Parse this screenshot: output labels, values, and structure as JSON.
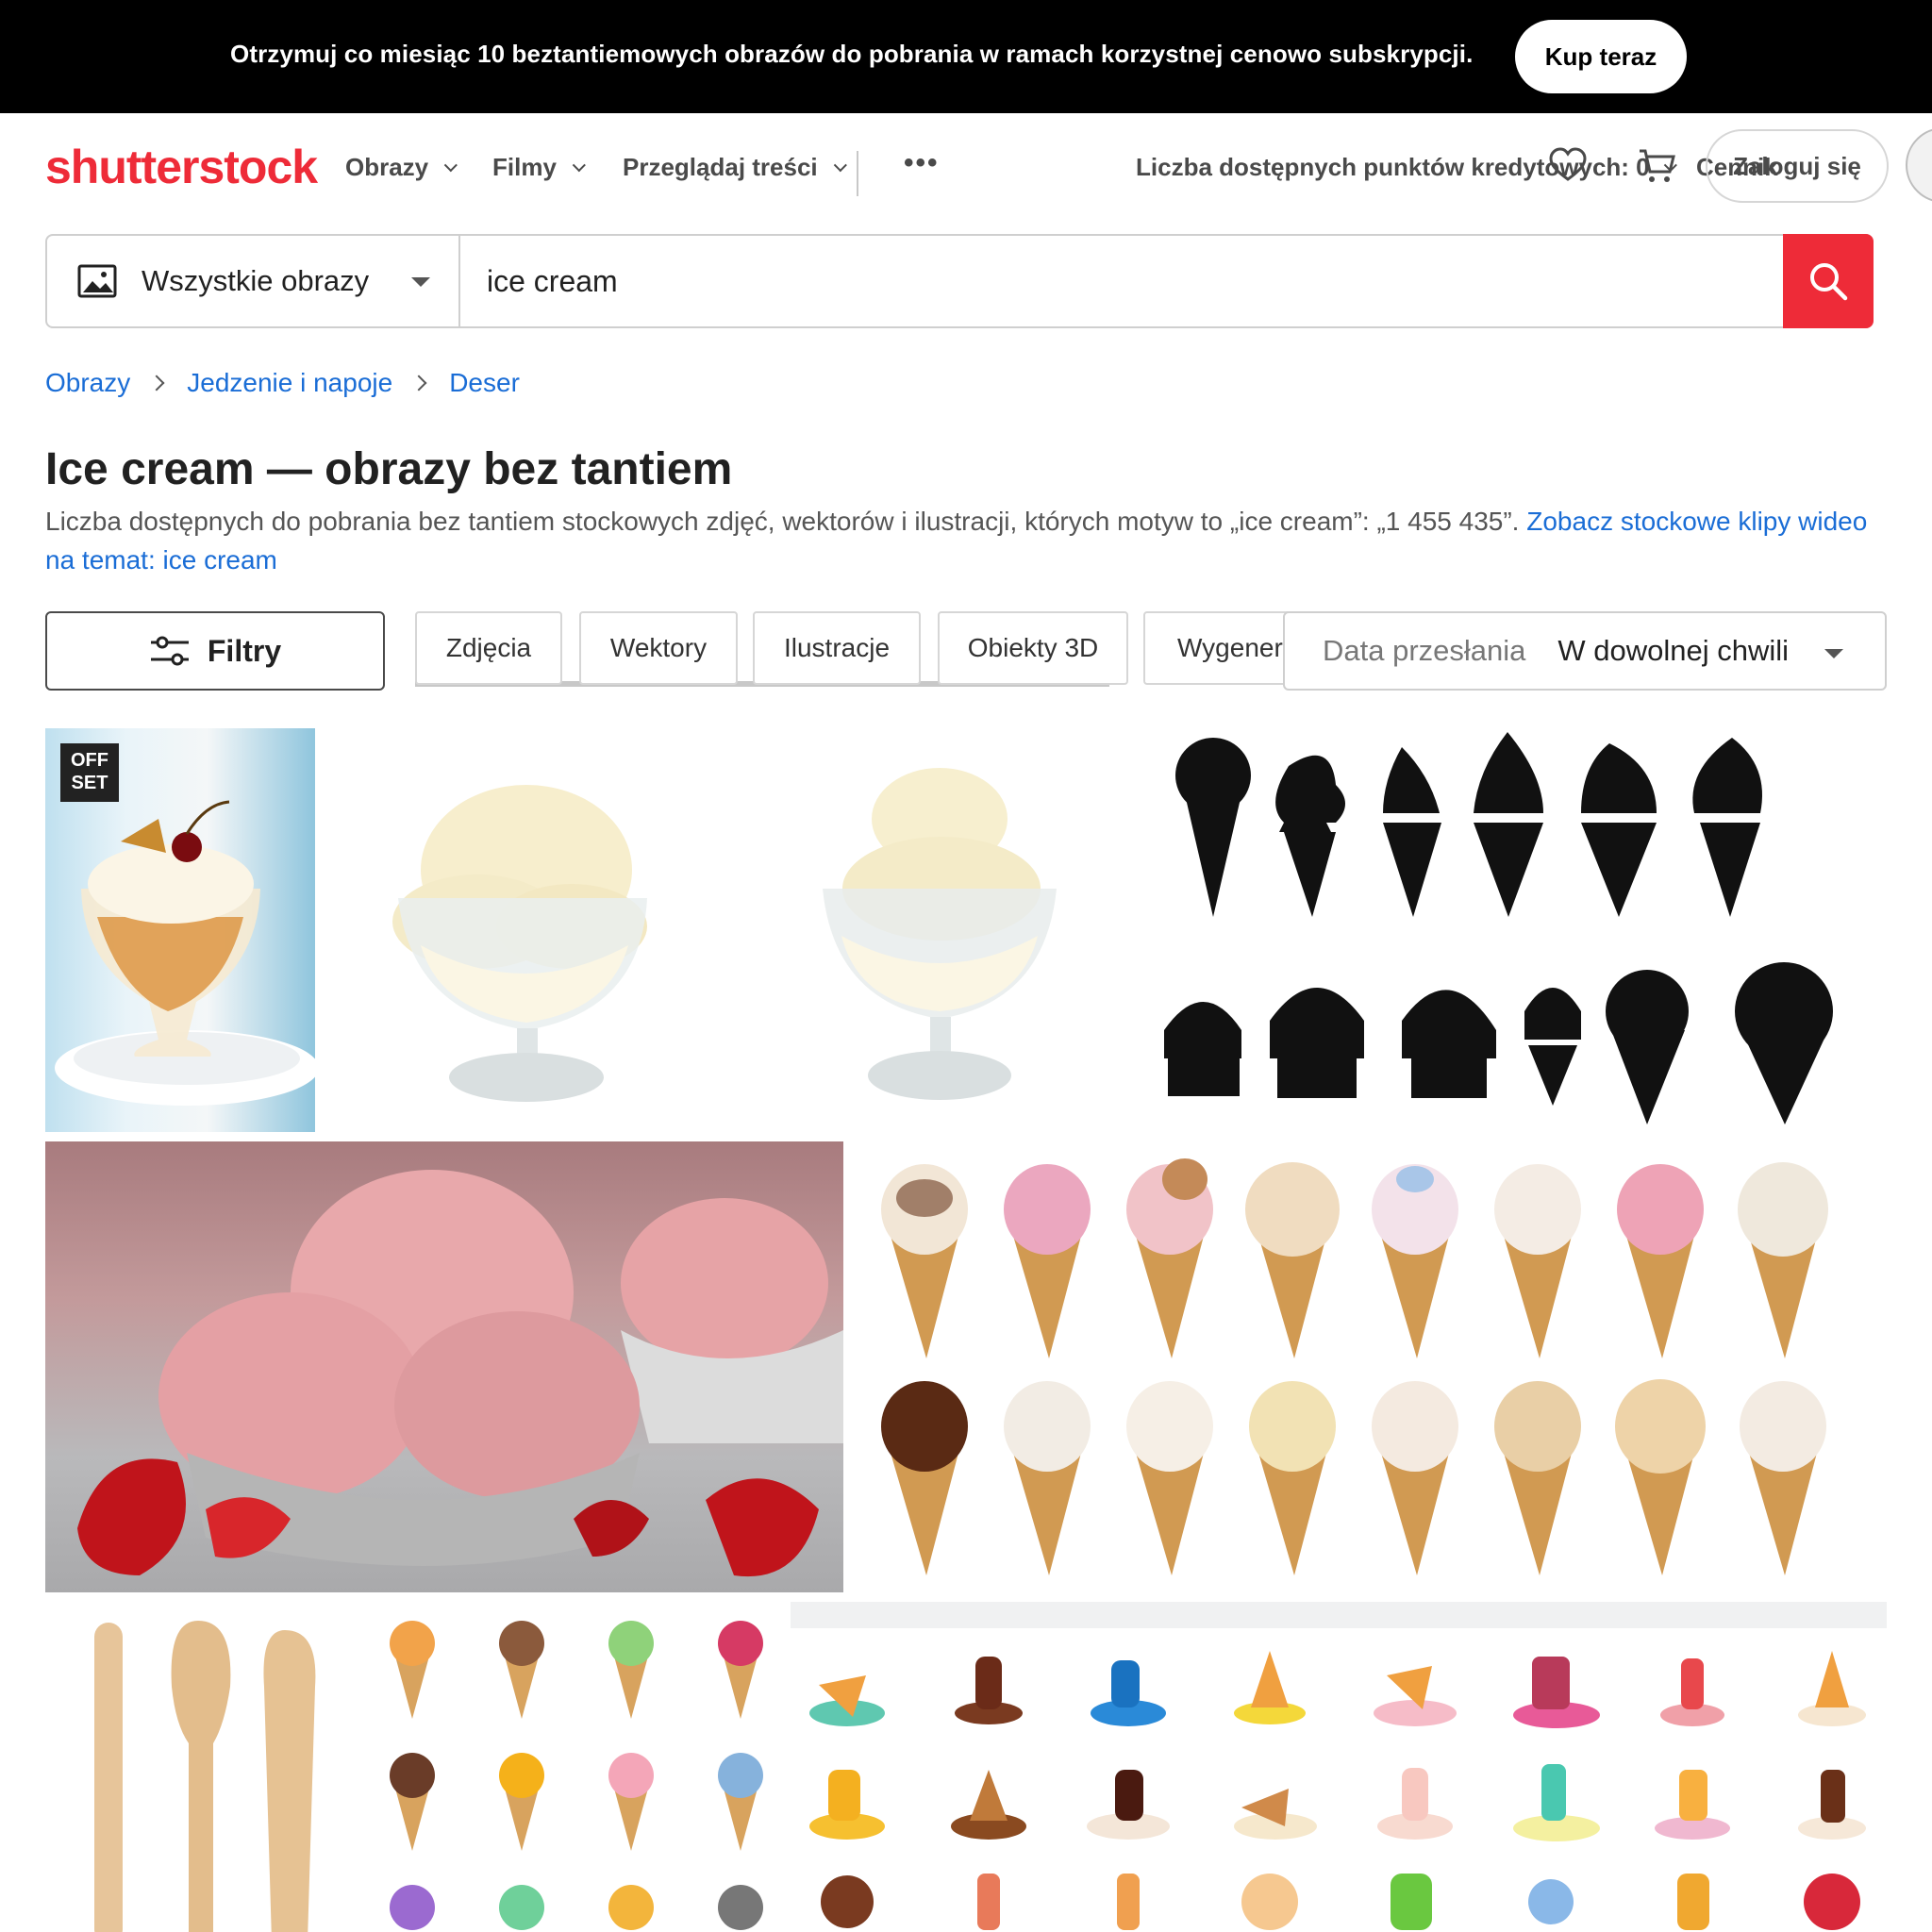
{
  "promo": {
    "text": "Otrzymuj co miesiąc 10 beztantiemowych obrazów do pobrania w ramach korzystnej cenowo subskrypcji.",
    "cta": "Kup teraz"
  },
  "header": {
    "logo": "shutterstock",
    "nav": [
      "Obrazy",
      "Filmy",
      "Przeglądaj treści"
    ],
    "more": "•••",
    "credits": "Liczba dostępnych punktów kredytowych: 0",
    "pricing": "Cennik",
    "login": "Zaloguj się"
  },
  "search": {
    "type": "Wszystkie obrazy",
    "query": "ice cream"
  },
  "breadcrumb": [
    "Obrazy",
    "Jedzenie i napoje",
    "Deser"
  ],
  "page": {
    "title": "Ice cream — obrazy bez tantiem",
    "subtitle": "Liczba dostępnych do pobrania bez tantiem stockowych zdjęć, wektorów i ilustracji, których motyw to „ice cream”: „1 455 435”.",
    "video_link": "Zobacz stockowe klipy wideo na temat: ice cream"
  },
  "filters": {
    "button": "Filtry",
    "chips": [
      "Zdjęcia",
      "Wektory",
      "Ilustracje",
      "Obiekty 3D",
      "Wygenerowane"
    ],
    "date_label": "Data przesłania",
    "date_value": "W dowolnej chwili"
  },
  "grid": {
    "offset_badge": "OFF SET"
  },
  "colors": {
    "brand": "#ee2b38",
    "link": "#1a6dd6",
    "banner": "#000000"
  }
}
